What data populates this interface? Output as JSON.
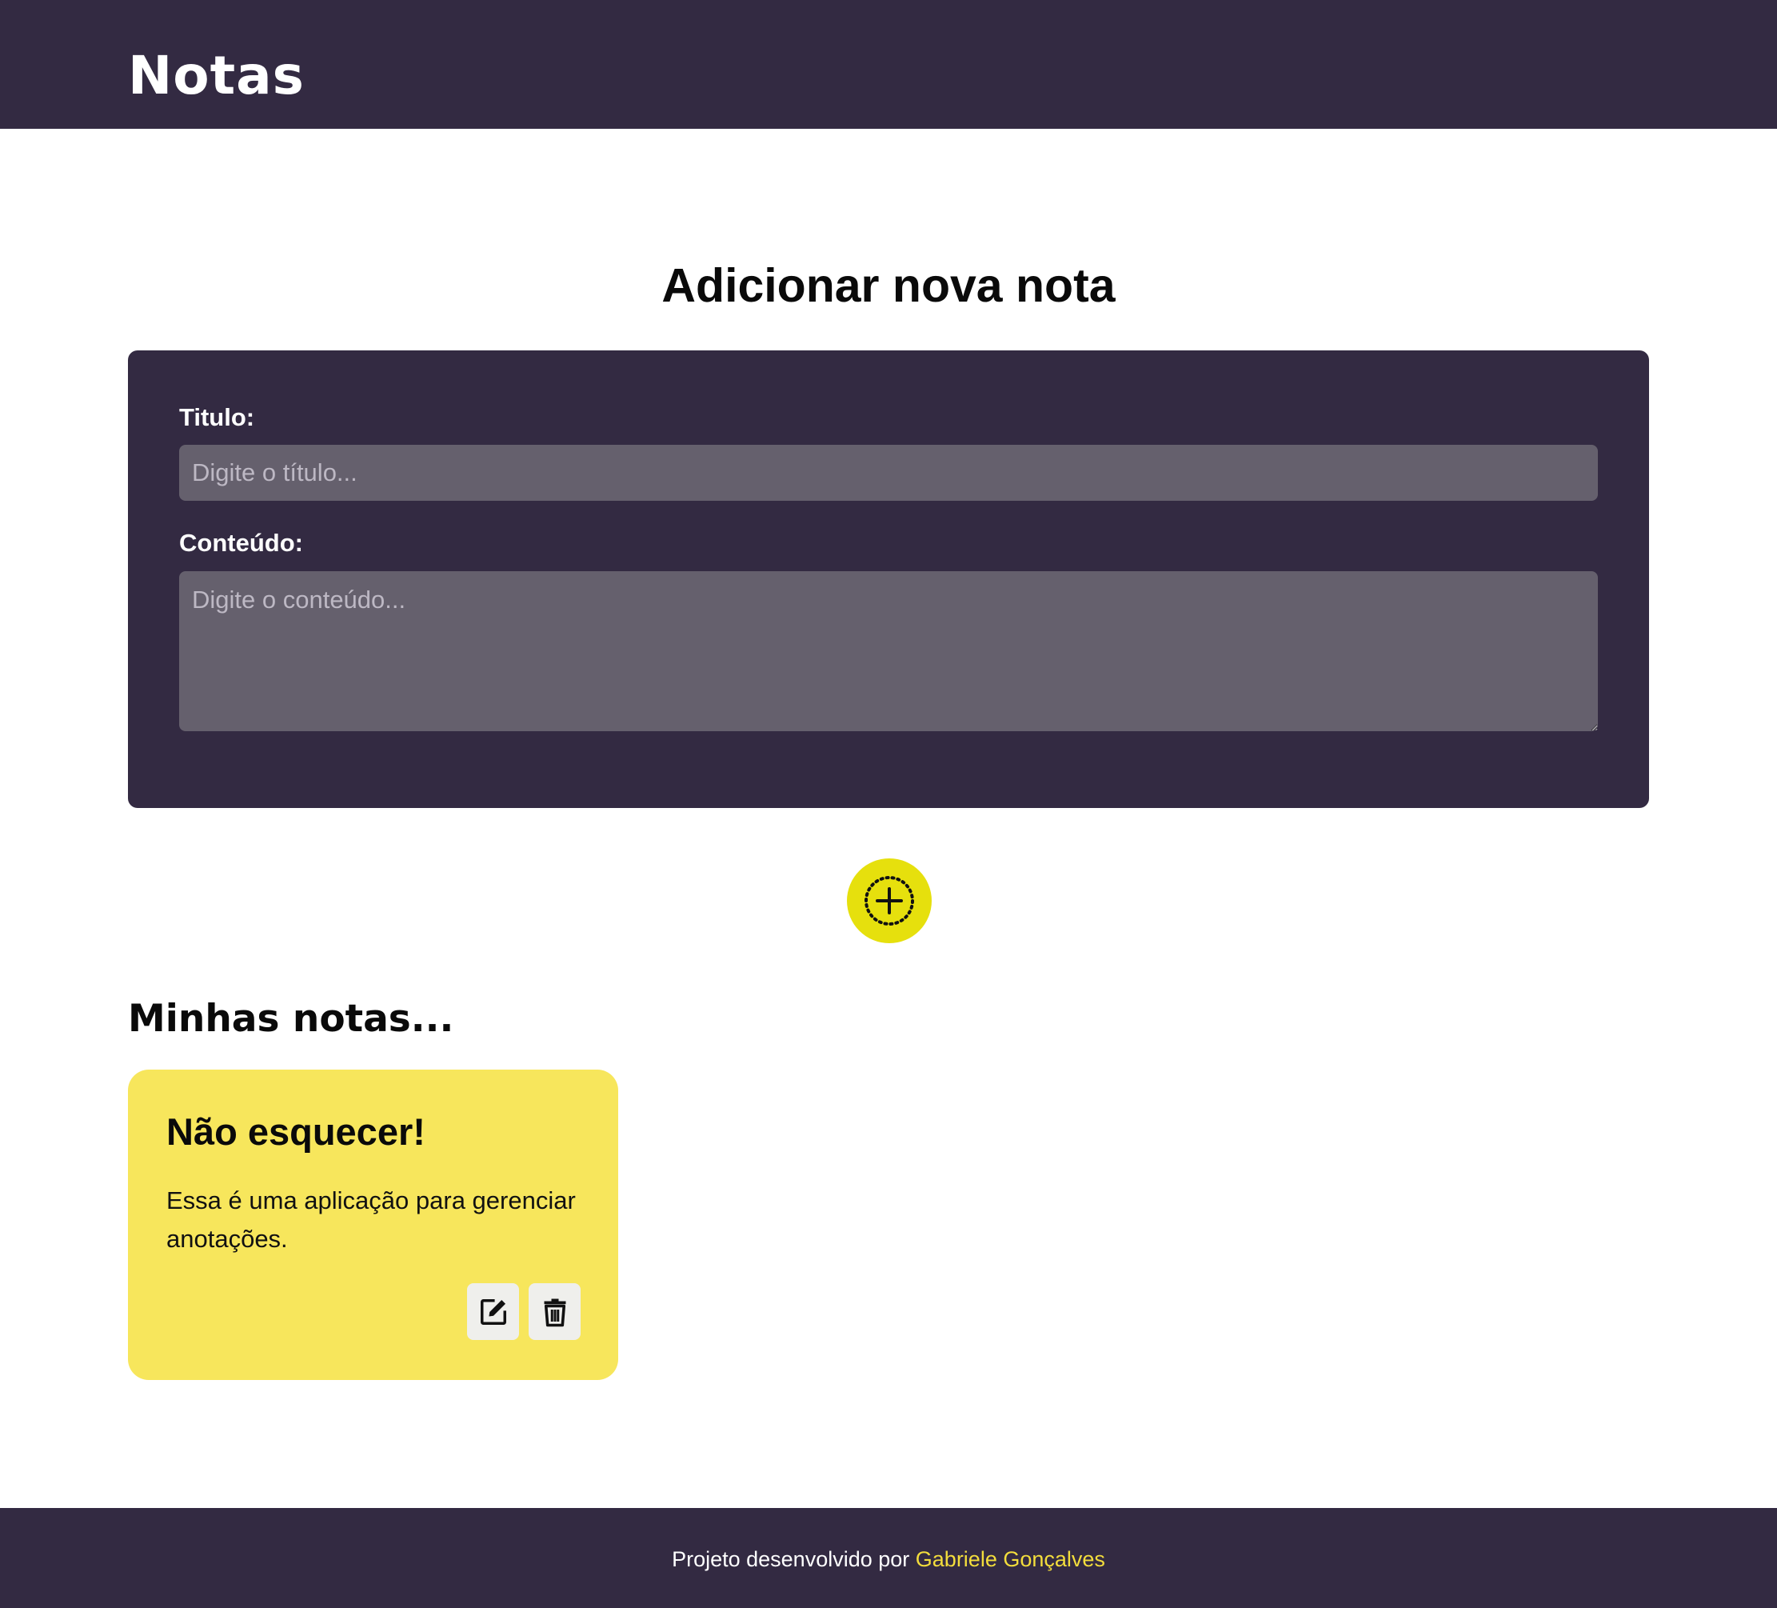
{
  "header": {
    "logo": "Notas"
  },
  "form": {
    "heading": "Adicionar nova nota",
    "title_label": "Titulo:",
    "title_placeholder": "Digite o título...",
    "title_value": "",
    "content_label": "Conteúdo:",
    "content_placeholder": "Digite o conteúdo...",
    "content_value": "",
    "add_button_icon": "plus-circle-icon"
  },
  "notes_section": {
    "heading": "Minhas notas...",
    "notes": [
      {
        "title": "Não esquecer!",
        "body": "Essa é uma aplicação para gerenciar anotações.",
        "edit_icon": "edit-icon",
        "delete_icon": "trash-icon"
      }
    ]
  },
  "footer": {
    "text": "Projeto desenvolvido por",
    "author": "Gabriele Gonçalves"
  },
  "colors": {
    "primary_dark": "#332a42",
    "input_bg": "#65606d",
    "accent_yellow": "#e6e00d",
    "note_yellow": "#f7e65c",
    "footer_link": "#f3dd3c"
  }
}
